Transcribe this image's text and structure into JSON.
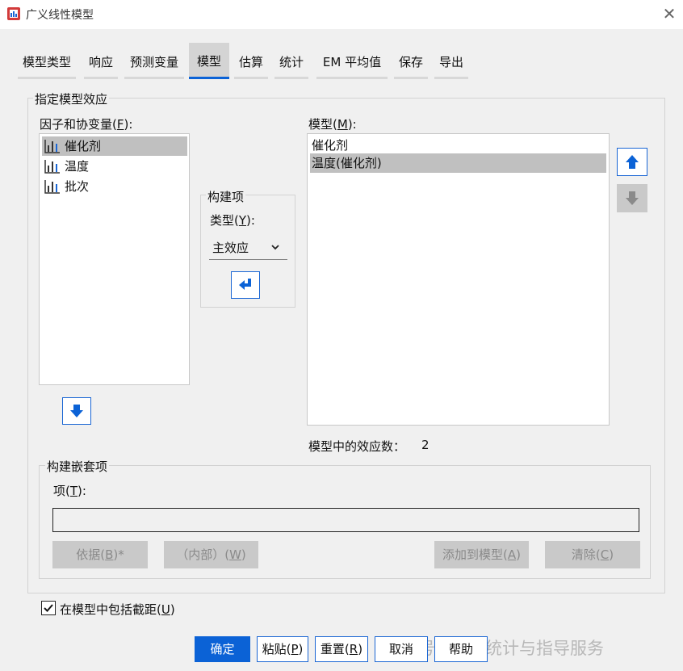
{
  "window": {
    "title": "广义线性模型",
    "close_symbol": "✕"
  },
  "tabs": [
    {
      "label": "模型类型"
    },
    {
      "label": "响应"
    },
    {
      "label": "预测变量"
    },
    {
      "label": "模型"
    },
    {
      "label": "估算"
    },
    {
      "label": "统计"
    },
    {
      "label": "EM 平均值"
    },
    {
      "label": "保存"
    },
    {
      "label": "导出"
    }
  ],
  "active_tab": "模型",
  "effects_group": {
    "label": "指定模型效应",
    "factors": {
      "label_pre": "因子和协变量(",
      "label_key": "F",
      "label_post": "):",
      "items": [
        {
          "label": "催化剂",
          "selected": true
        },
        {
          "label": "温度",
          "selected": false
        },
        {
          "label": "批次",
          "selected": false
        }
      ]
    },
    "build_terms": {
      "label": "构建项",
      "type_label_pre": "类型(",
      "type_label_key": "Y",
      "type_label_post": "):",
      "type_value": "主效应"
    },
    "model": {
      "label_pre": "模型(",
      "label_key": "M",
      "label_post": "):",
      "items": [
        {
          "label": "催化剂",
          "selected": false
        },
        {
          "label": "温度(催化剂)",
          "selected": true
        }
      ],
      "effect_count_label": "模型中的效应数：",
      "effect_count": "2"
    },
    "nested": {
      "label": "构建嵌套项",
      "term_label_pre": "项(",
      "term_label_key": "T",
      "term_label_post": "):",
      "term_value": "",
      "buttons": {
        "by": {
          "pre": "依据(",
          "key": "B",
          "post": ")*"
        },
        "within": {
          "pre": "（内部）(",
          "key": "W",
          "post": ")"
        },
        "add": {
          "pre": "添加到模型(",
          "key": "A",
          "post": ")"
        },
        "clear": {
          "pre": "清除(",
          "key": "C",
          "post": ")"
        }
      }
    }
  },
  "intercept": {
    "pre": "在模型中包括截距(",
    "key": "U",
    "post": ")",
    "checked": true
  },
  "footer": {
    "ok": "确定",
    "paste": {
      "pre": "粘贴(",
      "key": "P",
      "post": ")"
    },
    "reset": {
      "pre": "重置(",
      "key": "R",
      "post": ")"
    },
    "cancel": "取消",
    "help": "帮助"
  },
  "watermark": "公众号 · 论文统计与指导服务",
  "colors": {
    "accent": "#0b62d6",
    "selected": "#c0c0c0",
    "disabled": "#c9c9c9"
  }
}
